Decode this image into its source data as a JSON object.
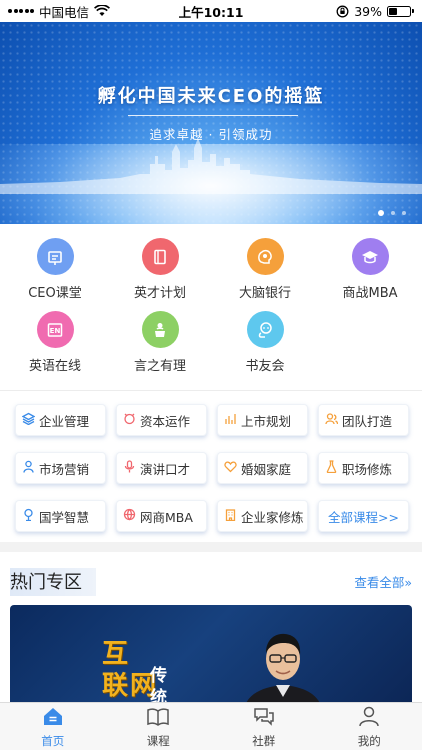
{
  "status_bar": {
    "carrier": "中国电信",
    "time": "上午10:11",
    "battery": "39%",
    "battery_level": 0.39
  },
  "banner": {
    "title": "孵化中国未来CEO的摇篮",
    "subtitle": "追求卓越 · 引领成功",
    "pages": 3,
    "active_page": 0
  },
  "features": [
    {
      "label": "CEO课堂",
      "icon": "classroom-icon",
      "color": "#6f9ff2"
    },
    {
      "label": "英才计划",
      "icon": "book-icon",
      "color": "#f0676e"
    },
    {
      "label": "大脑银行",
      "icon": "brain-icon",
      "color": "#f5a03b"
    },
    {
      "label": "商战MBA",
      "icon": "graduation-cap-icon",
      "color": "#9f7ef0"
    },
    {
      "label": "英语在线",
      "icon": "english-en-icon",
      "color": "#f06bb0"
    },
    {
      "label": "言之有理",
      "icon": "speaker-podium-icon",
      "color": "#8dd064"
    },
    {
      "label": "书友会",
      "icon": "people-chat-icon",
      "color": "#5ec8ee"
    }
  ],
  "courses": [
    {
      "label": "企业管理",
      "icon": "layers-icon",
      "color": "#3a8be8"
    },
    {
      "label": "资本运作",
      "icon": "capital-icon",
      "color": "#f0676e"
    },
    {
      "label": "上市规划",
      "icon": "bar-chart-icon",
      "color": "#f5a03b"
    },
    {
      "label": "团队打造",
      "icon": "team-icon",
      "color": "#f5a03b"
    },
    {
      "label": "市场营销",
      "icon": "person-icon",
      "color": "#3a8be8"
    },
    {
      "label": "演讲口才",
      "icon": "microphone-icon",
      "color": "#f0676e"
    },
    {
      "label": "婚姻家庭",
      "icon": "heart-icon",
      "color": "#f5a03b"
    },
    {
      "label": "职场修炼",
      "icon": "flask-icon",
      "color": "#f5a03b"
    },
    {
      "label": "国学智慧",
      "icon": "tree-icon",
      "color": "#3a8be8"
    },
    {
      "label": "网商MBA",
      "icon": "globe-icon",
      "color": "#f0676e"
    },
    {
      "label": "企业家修炼",
      "icon": "building-icon",
      "color": "#f5a03b"
    }
  ],
  "all_courses_label": "全部课程>>",
  "hot": {
    "title": "热门专区",
    "more": "查看全部»",
    "card_line1": "互",
    "card_line2": "联网",
    "card_line3": "传",
    "card_line4": "统"
  },
  "tabs": [
    {
      "label": "首页",
      "icon": "home-icon",
      "active": true
    },
    {
      "label": "课程",
      "icon": "open-book-icon",
      "active": false
    },
    {
      "label": "社群",
      "icon": "chat-bubbles-icon",
      "active": false
    },
    {
      "label": "我的",
      "icon": "user-icon",
      "active": false
    }
  ],
  "colors": {
    "accent": "#3a8be8",
    "tab_inactive": "#444444"
  }
}
